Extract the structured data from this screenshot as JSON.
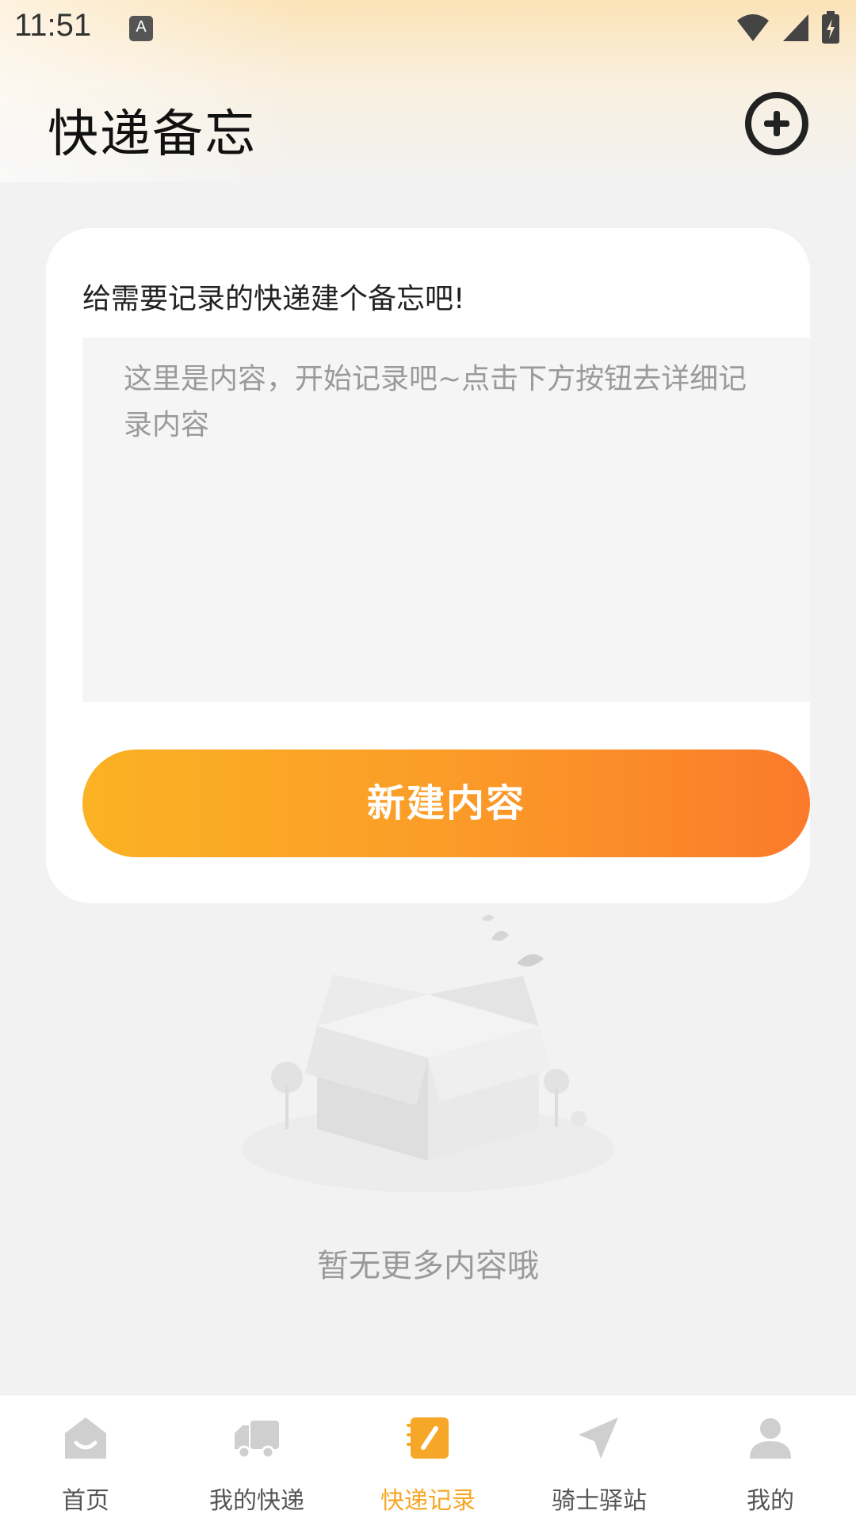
{
  "status_bar": {
    "time": "11:51",
    "notification_icon_letter": "A",
    "icons": [
      "wifi-icon",
      "signal-icon",
      "battery-charging-icon"
    ]
  },
  "header": {
    "title": "快递备忘",
    "add_icon": "plus-circle-icon"
  },
  "memo_card": {
    "heading": "给需要记录的快递建个备忘吧!",
    "placeholder": "这里是内容，开始记录吧~点击下方按钮去详细记录内容",
    "button_label": "新建内容"
  },
  "empty_state": {
    "illustration": "empty-box-icon",
    "message": "暂无更多内容哦"
  },
  "tab_bar": {
    "items": [
      {
        "label": "首页",
        "icon": "home-icon",
        "active": false
      },
      {
        "label": "我的快递",
        "icon": "truck-icon",
        "active": false
      },
      {
        "label": "快递记录",
        "icon": "notebook-icon",
        "active": true
      },
      {
        "label": "骑士驿站",
        "icon": "paper-plane-icon",
        "active": false
      },
      {
        "label": "我的",
        "icon": "person-icon",
        "active": false
      }
    ]
  },
  "colors": {
    "accent": "#f7a727",
    "button_gradient_start": "#fbb224",
    "button_gradient_end": "#fb7a2a",
    "inactive_icon": "#cfcfcf"
  }
}
